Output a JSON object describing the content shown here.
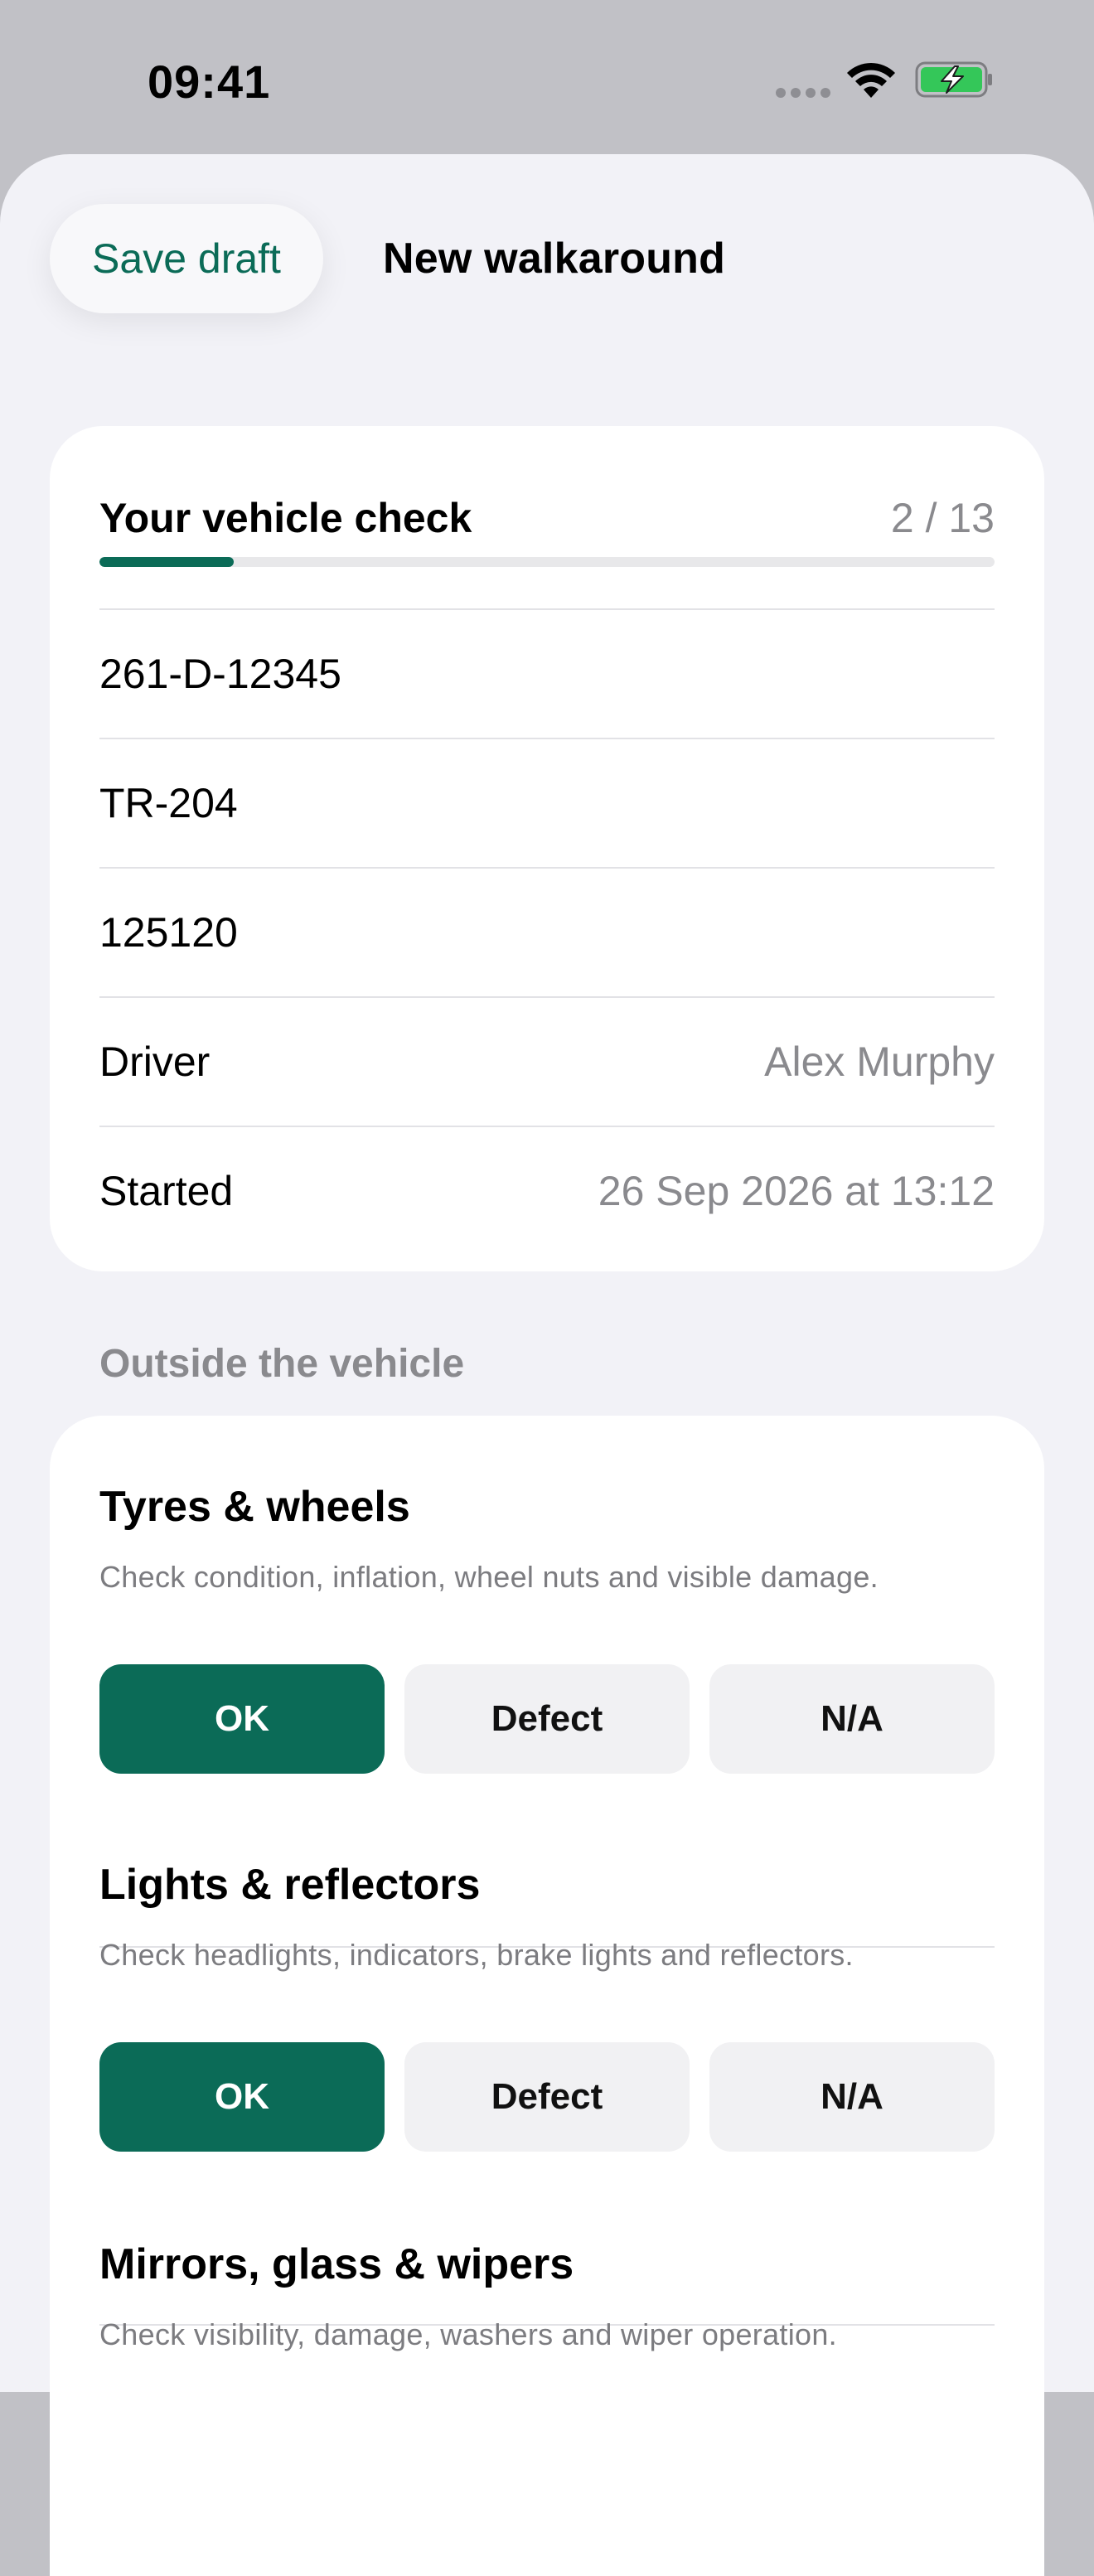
{
  "status": {
    "time": "09:41"
  },
  "header": {
    "save_draft": "Save draft",
    "title": "New walkaround"
  },
  "summary": {
    "title": "Your vehicle check",
    "count": "2 / 13",
    "progress": 0.15,
    "registration": "261-D-12345",
    "trailer": "TR-204",
    "odometer": "125120",
    "driver_label": "Driver",
    "driver_value": "Alex Murphy",
    "started_label": "Started",
    "started_value": "26 Sep 2026 at 13:12"
  },
  "section": {
    "title": "Outside the vehicle"
  },
  "options": {
    "ok": "OK",
    "defect": "Defect",
    "na": "N/A"
  },
  "items": [
    {
      "title": "Tyres & wheels",
      "desc": "Check condition, inflation, wheel nuts and visible damage.",
      "selected": "ok"
    },
    {
      "title": "Lights & reflectors",
      "desc": "Check headlights, indicators, brake lights and reflectors.",
      "selected": "ok"
    },
    {
      "title": "Mirrors, glass & wipers",
      "desc": "Check visibility, damage, washers and wiper operation.",
      "selected": ""
    }
  ],
  "colors": {
    "accent": "#0b6b57",
    "battery": "#34c759"
  }
}
